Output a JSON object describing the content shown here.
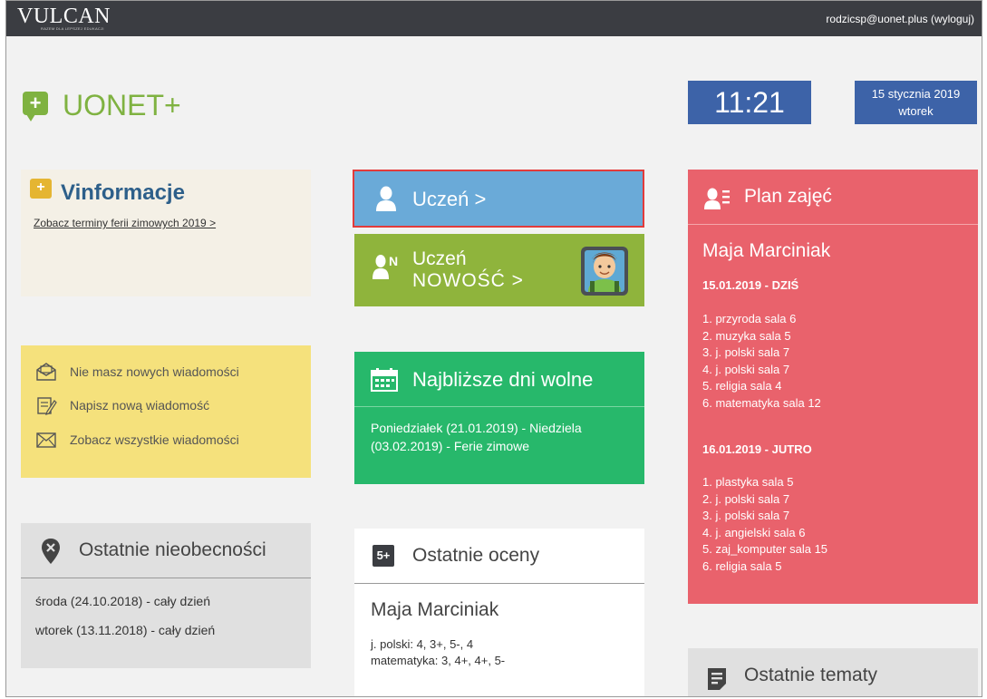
{
  "topbar": {
    "brand": "VULCAN",
    "brand_tagline": "RAZEM DLA LEPSZEJ EDUKACJI",
    "user": "rodzicsp@uonet.plus (wyloguj)"
  },
  "logo": {
    "icon_text": "+",
    "text": "UONET+"
  },
  "clock": {
    "time": "11:21"
  },
  "date": {
    "date": "15 stycznia 2019",
    "weekday": "wtorek"
  },
  "vinformacje": {
    "title": "Vinformacje",
    "link": "Zobacz terminy ferii zimowych 2019 >"
  },
  "messages": {
    "items": [
      {
        "label": "Nie masz nowych wiadomości",
        "icon": "envelope-open-icon"
      },
      {
        "label": "Napisz nową wiadomość",
        "icon": "compose-icon"
      },
      {
        "label": "Zobacz wszystkie wiadomości",
        "icon": "envelope-icon"
      }
    ]
  },
  "absences": {
    "title": "Ostatnie nieobecności",
    "rows": [
      "środa (24.10.2018) - cały dzień",
      "wtorek (13.11.2018) - cały dzień"
    ]
  },
  "student": {
    "label": "Uczeń >"
  },
  "student_new": {
    "line1": "Uczeń",
    "line2": "NOWOŚĆ >",
    "badge": "N"
  },
  "holidays": {
    "title": "Najbliższe dni wolne",
    "text": "Poniedziałek (21.01.2019) - Niedziela (03.02.2019) - Ferie zimowe"
  },
  "grades": {
    "icon_text": "5+",
    "title": "Ostatnie oceny",
    "student": "Maja Marciniak",
    "rows": [
      "j. polski: 4, 3+, 5-, 4",
      "matematyka: 3, 4+, 4+, 5-"
    ]
  },
  "plan": {
    "title": "Plan zajęć",
    "student": "Maja Marciniak",
    "days": [
      {
        "heading": "15.01.2019 - DZIŚ",
        "lessons": [
          "1. przyroda sala 6",
          "2. muzyka sala 5",
          "3. j. polski sala 7",
          "4. j. polski sala 7",
          "5. religia sala 4",
          "6. matematyka sala 12"
        ]
      },
      {
        "heading": "16.01.2019 - JUTRO",
        "lessons": [
          "1. plastyka sala 5",
          "2. j. polski sala 7",
          "3. j. polski sala 7",
          "4. j. angielski sala 6",
          "5. zaj_komputer sala 15",
          "6. religia sala 5"
        ]
      }
    ]
  },
  "topics": {
    "title": "Ostatnie tematy"
  },
  "colors": {
    "topbar": "#3b3d42",
    "brand_green": "#7fb241",
    "clock_blue": "#3d63a8",
    "student_blue": "#6aaad8",
    "student_new_green": "#8fb43c",
    "holidays_green": "#27b86b",
    "plan_red": "#e9626c",
    "messages_yellow": "#f5e17c",
    "vinfo_bg": "#f4f0e6",
    "highlight_border": "#e23b3b"
  }
}
